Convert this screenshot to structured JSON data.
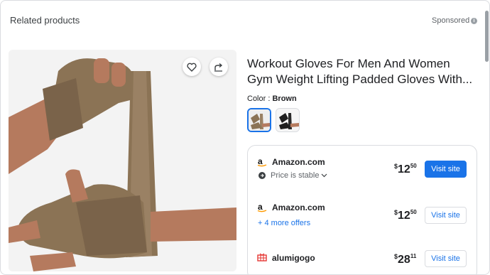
{
  "header": {
    "title": "Related products",
    "sponsored": "Sponsored",
    "info_glyph": "i"
  },
  "product": {
    "title_line1": "Workout Gloves For Men And Women",
    "title_line2": "Gym Weight Lifting Padded Gloves With...",
    "color_label": "Color : ",
    "color_value": "Brown",
    "swatches": [
      "brown-gloves-swatch",
      "black-gloves-swatch"
    ]
  },
  "offers": [
    {
      "seller": "Amazon.com",
      "logo": "amazon-icon",
      "price_symbol": "$",
      "price_whole": "12",
      "price_cents": "50",
      "sub_text": "Price is stable",
      "button": "Visit site",
      "primary": true
    },
    {
      "seller": "Amazon.com",
      "logo": "amazon-icon",
      "price_symbol": "$",
      "price_whole": "12",
      "price_cents": "50",
      "sub_text": "+ 4 more offers",
      "button": "Visit site",
      "primary": false
    },
    {
      "seller": "alumigogo",
      "logo": "alumigogo-icon",
      "price_symbol": "$",
      "price_whole": "28",
      "price_cents": "11",
      "button": "Visit site",
      "primary": false
    }
  ],
  "colors": {
    "accent": "#1a73e8",
    "glove_brown": "#8b7355"
  }
}
